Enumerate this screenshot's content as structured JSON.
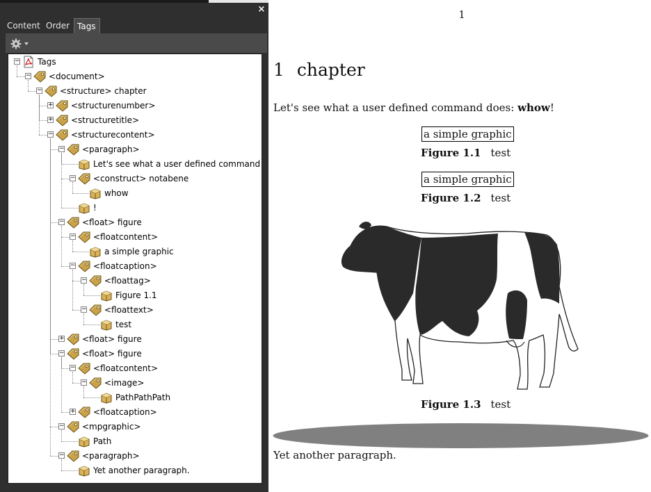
{
  "panel": {
    "close_symbol": "×",
    "tabs": [
      {
        "label": "Content"
      },
      {
        "label": "Order"
      },
      {
        "label": "Tags"
      }
    ],
    "options_icon": "gear-icon",
    "tree": [
      {
        "label": "Tags",
        "toggle": "−",
        "icon": "pdf-icon"
      },
      {
        "label": "<document>",
        "toggle": "−",
        "icon": "tag-icon"
      },
      {
        "label": "<structure> chapter",
        "toggle": "−",
        "icon": "tag-icon"
      },
      {
        "label": "<structurenumber>",
        "toggle": "+",
        "icon": "tag-icon"
      },
      {
        "label": "<structuretitle>",
        "toggle": "+",
        "icon": "tag-icon"
      },
      {
        "label": "<structurecontent>",
        "toggle": "−",
        "icon": "tag-icon"
      },
      {
        "label": "<paragraph>",
        "toggle": "−",
        "icon": "tag-icon"
      },
      {
        "label": "Let's see what a user defined command does:",
        "toggle": "",
        "icon": "content-box-icon"
      },
      {
        "label": "<construct> notabene",
        "toggle": "−",
        "icon": "tag-icon"
      },
      {
        "label": "whow",
        "toggle": "",
        "icon": "content-box-icon"
      },
      {
        "label": "!",
        "toggle": "",
        "icon": "content-box-icon"
      },
      {
        "label": "<float> figure",
        "toggle": "−",
        "icon": "tag-icon"
      },
      {
        "label": "<floatcontent>",
        "toggle": "−",
        "icon": "tag-icon"
      },
      {
        "label": "a simple graphic",
        "toggle": "",
        "icon": "content-box-icon"
      },
      {
        "label": "<floatcaption>",
        "toggle": "−",
        "icon": "tag-icon"
      },
      {
        "label": "<floattag>",
        "toggle": "−",
        "icon": "tag-icon"
      },
      {
        "label": "Figure 1.1",
        "toggle": "",
        "icon": "content-box-icon"
      },
      {
        "label": "<floattext>",
        "toggle": "−",
        "icon": "tag-icon"
      },
      {
        "label": "test",
        "toggle": "",
        "icon": "content-box-icon"
      },
      {
        "label": "<float> figure",
        "toggle": "+",
        "icon": "tag-icon"
      },
      {
        "label": "<float> figure",
        "toggle": "−",
        "icon": "tag-icon"
      },
      {
        "label": "<floatcontent>",
        "toggle": "−",
        "icon": "tag-icon"
      },
      {
        "label": "<image>",
        "toggle": "−",
        "icon": "tag-icon"
      },
      {
        "label": "PathPathPath",
        "toggle": "",
        "icon": "content-box-icon"
      },
      {
        "label": "<floatcaption>",
        "toggle": "+",
        "icon": "tag-icon"
      },
      {
        "label": "<mpgraphic>",
        "toggle": "−",
        "icon": "tag-icon"
      },
      {
        "label": "Path",
        "toggle": "",
        "icon": "content-box-icon"
      },
      {
        "label": "<paragraph>",
        "toggle": "−",
        "icon": "tag-icon"
      },
      {
        "label": "Yet another paragraph.",
        "toggle": "",
        "icon": "content-box-icon"
      }
    ]
  },
  "document": {
    "page_number": "1",
    "chapter_number": "1",
    "chapter_title": "chapter",
    "para1_prefix": "Let's see what a user defined command does:",
    "para1_bold": "whow",
    "para1_suffix": "!",
    "figures": [
      {
        "graphic_text": "a simple graphic",
        "tag": "Figure 1.1",
        "text": "test"
      },
      {
        "graphic_text": "a simple graphic",
        "tag": "Figure 1.2",
        "text": "test"
      },
      {
        "graphic_text": "",
        "tag": "Figure 1.3",
        "text": "test"
      }
    ],
    "para2": "Yet another paragraph.",
    "colors": {
      "shadow": "#808080",
      "cow_black": "#2a2a2a"
    }
  }
}
